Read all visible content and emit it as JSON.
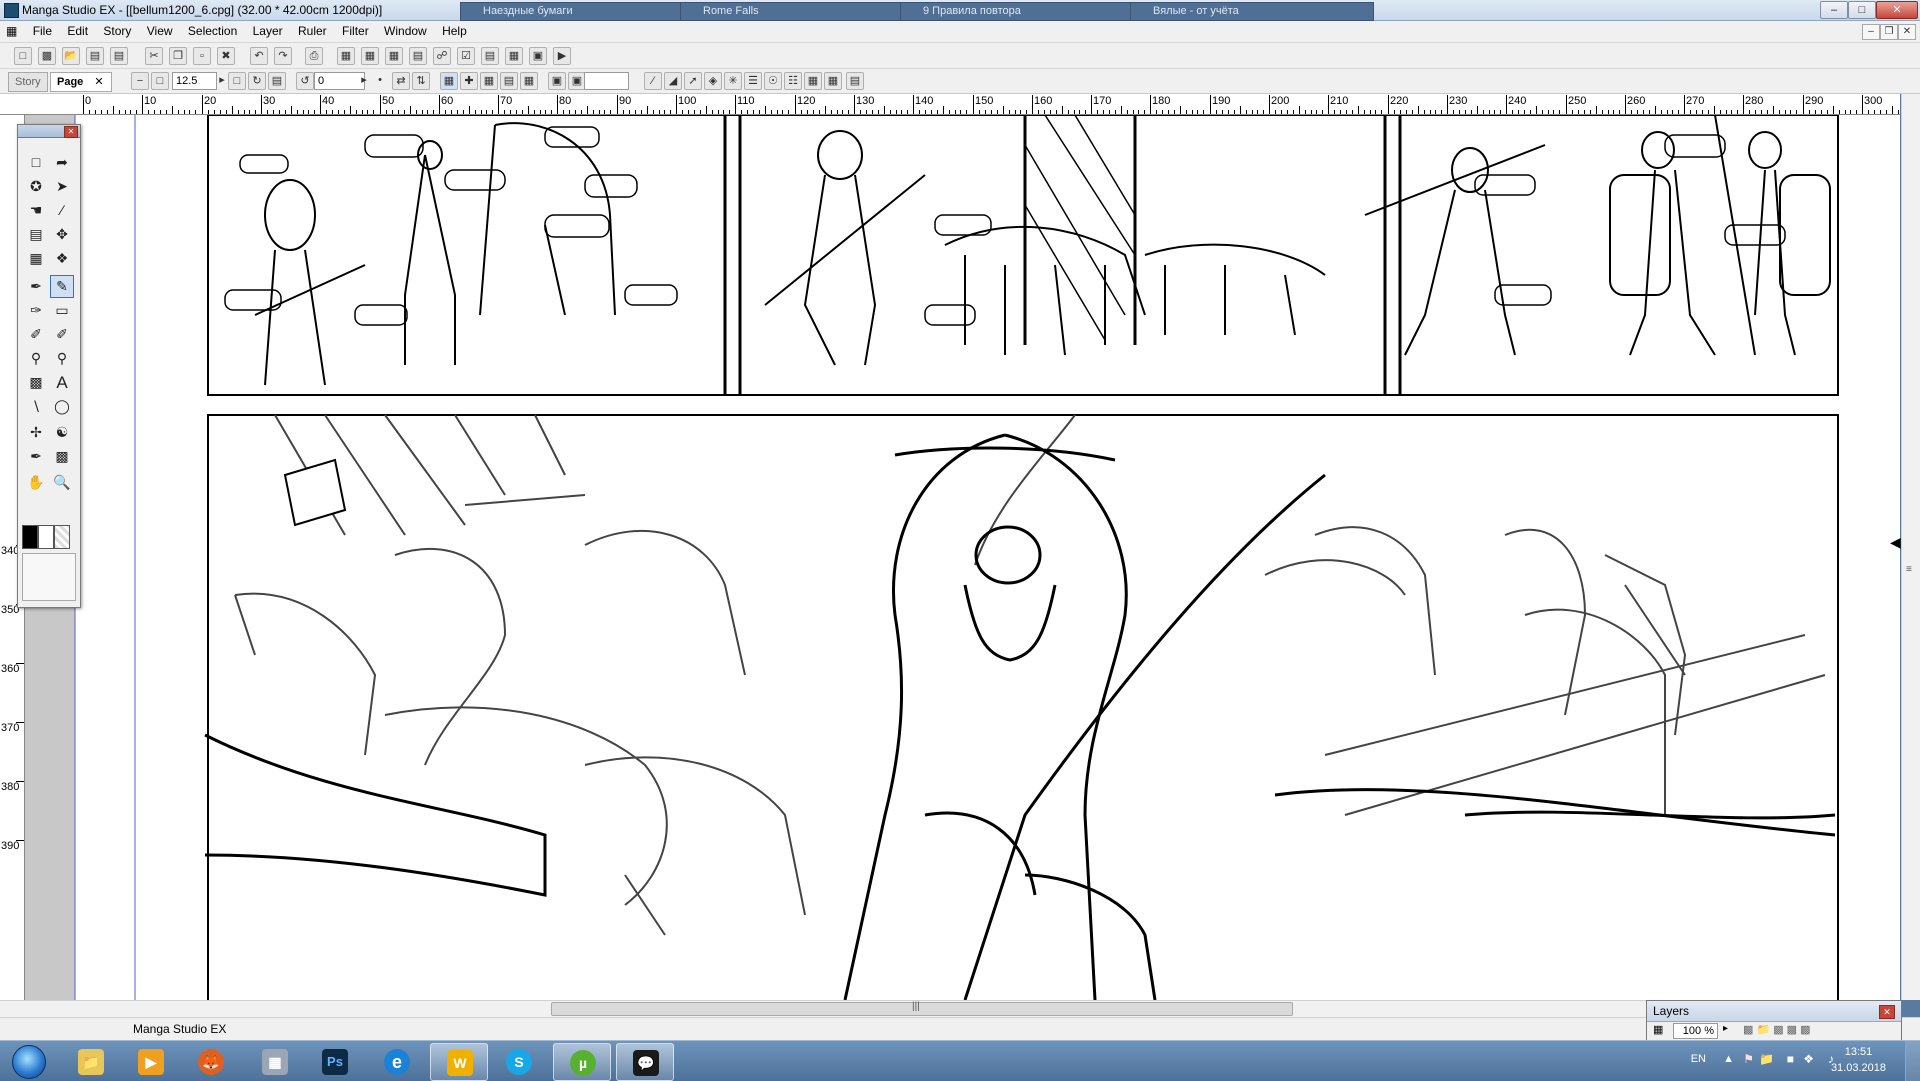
{
  "window": {
    "title": "Manga Studio EX - [[bellum1200_6.cpg] (32.00 * 42.00cm 1200dpi)]",
    "background_tabs": [
      "Наездные бумаги",
      "Rome Falls",
      "9 Правила повтора",
      "Вялые - от учёта"
    ],
    "controls": {
      "minimize": "–",
      "maximize": "□",
      "close": "✕"
    }
  },
  "menu": {
    "items": [
      "File",
      "Edit",
      "Story",
      "View",
      "Selection",
      "Layer",
      "Ruler",
      "Filter",
      "Window",
      "Help"
    ],
    "mdi_controls": [
      "–",
      "❐",
      "✕"
    ]
  },
  "toolbar": {
    "tabs": {
      "story": "Story",
      "page": "Page",
      "close": "✕"
    },
    "zoom_value": "12.5",
    "rotate_value": "0"
  },
  "rulers": {
    "h_labels": [
      "0",
      "10",
      "20",
      "30",
      "40",
      "50",
      "60",
      "70",
      "80",
      "90",
      "100",
      "110",
      "120",
      "130",
      "140",
      "150",
      "160",
      "170",
      "180",
      "190",
      "200",
      "210",
      "220",
      "230",
      "240",
      "250",
      "260",
      "270",
      "280",
      "290",
      "300"
    ],
    "v_labels": [
      "340",
      "350",
      "360",
      "370",
      "380",
      "390"
    ]
  },
  "status": {
    "text": "Manga Studio EX"
  },
  "tools_palette": {
    "tools": [
      "marquee-icon",
      "lasso-icon",
      "magic-wand-icon",
      "select-object-icon",
      "move-icon",
      "hand-transform-icon",
      "ruler-icon",
      "move-layer-icon",
      "grid-icon",
      "zoom-layer-icon",
      "pen-icon",
      "pencil-icon",
      "marker-icon",
      "eraser-icon",
      "brush-icon",
      "correction-icon",
      "fill-icon",
      "pattern-fill-icon",
      "gradient-icon",
      "text-icon",
      "line-icon",
      "ellipse-icon",
      "tone-icon",
      "dust-icon",
      "pick-icon",
      "stamp-icon",
      "hand-icon",
      "zoom-icon"
    ],
    "colors": {
      "black": "#000000",
      "white": "#ffffff",
      "transparent": "#dcdcdc"
    }
  },
  "layers_palette": {
    "title": "Layers",
    "opacity": "100 %"
  },
  "taskbar": {
    "apps": [
      "Explorer",
      "Media Player",
      "Firefox",
      "Calculator",
      "Photoshop",
      "Internet Explorer",
      "Writer",
      "Skype",
      "uTorrent",
      "Manga Studio"
    ],
    "app_glyphs": [
      "📁",
      "▶",
      "🦊",
      "▦",
      "Ps",
      "e",
      "W",
      "S",
      "µ",
      "💬"
    ],
    "language": "EN",
    "time": "13:51",
    "date": "31.03.2018"
  },
  "colors": {
    "titlebar": "#c9d8ea",
    "taskbar": "#4d7199",
    "accent": "#3b6fb6"
  }
}
